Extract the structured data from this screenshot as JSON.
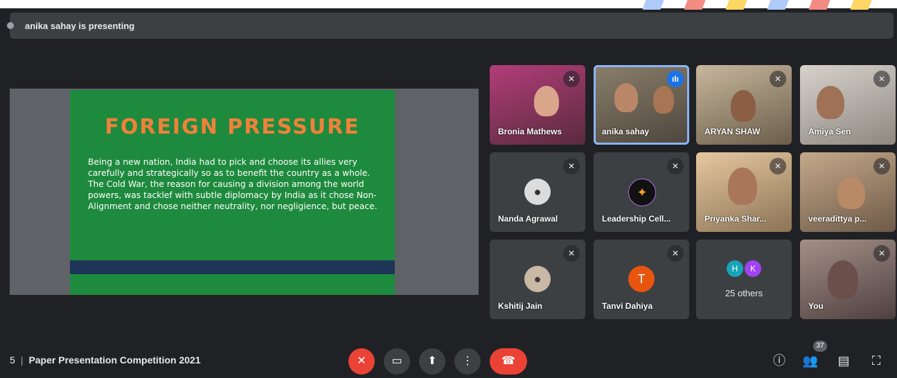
{
  "banner": {
    "presenting_text": "anika sahay is presenting"
  },
  "slide": {
    "title": "FOREIGN PRESSURE",
    "body": "Being a new nation, India had to pick and choose its allies very carefully and strategically so as to benefit the country as a whole. The Cold War, the reason for causing a division among the world powers, was tacklef with subtle diplomacy by India as it chose Non-Alignment and chose neither neutrality, nor negligience, but peace."
  },
  "participants": [
    {
      "name": "Bronia Mathews"
    },
    {
      "name": "anika sahay"
    },
    {
      "name": "ARYAN SHAW"
    },
    {
      "name": "Amiya Sen"
    },
    {
      "name": "Nanda Agrawal"
    },
    {
      "name": "Leadership Cell..."
    },
    {
      "name": "Priyanka Shar..."
    },
    {
      "name": "veeradittya p..."
    },
    {
      "name": "Kshitij Jain"
    },
    {
      "name": "Tanvi Dahiya",
      "initial": "T"
    },
    {
      "name": "25 others",
      "initials": [
        "H",
        "K"
      ]
    },
    {
      "name": "You"
    }
  ],
  "meeting": {
    "time_fragment": "5",
    "title": "Paper Presentation Competition 2021"
  },
  "people_count": "37",
  "colors": {
    "accent": "#8ab4f8",
    "danger": "#ea4335",
    "tanvi_avatar": "#e8550f",
    "h_avatar": "#1aa3b8",
    "k_avatar": "#a142f4"
  }
}
